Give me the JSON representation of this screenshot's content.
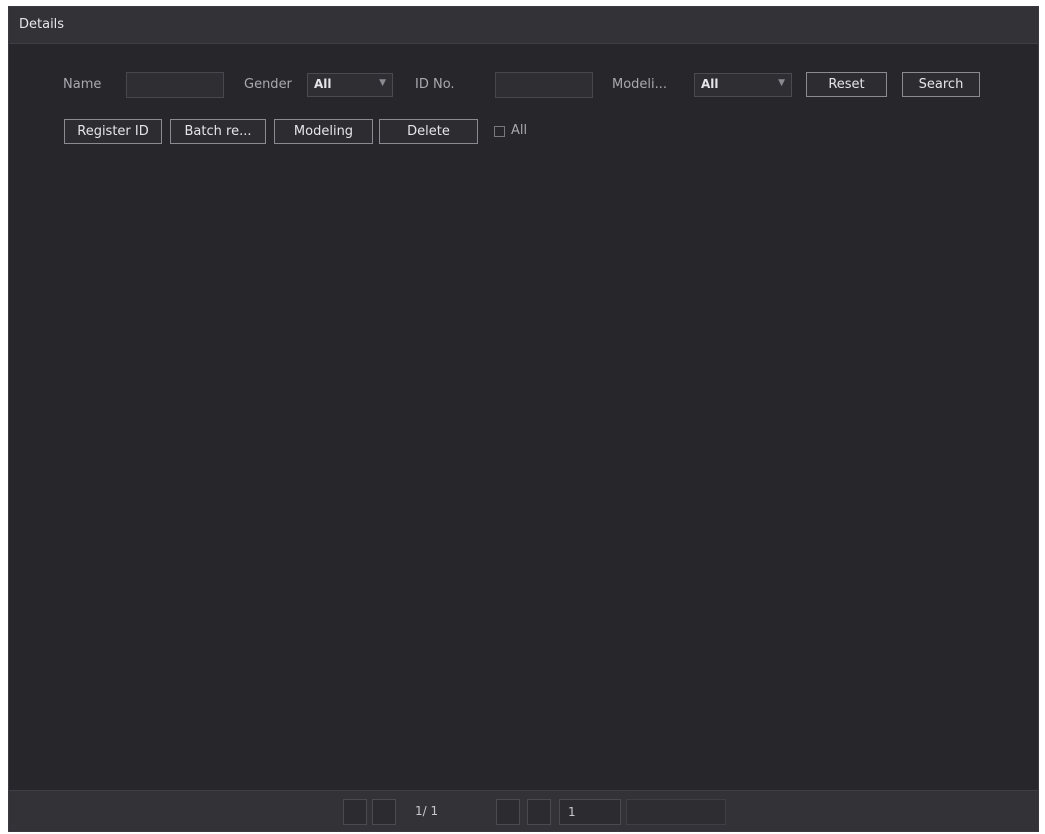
{
  "window": {
    "title": "Details"
  },
  "filters": {
    "name_label": "Name",
    "name_value": "",
    "gender_label": "Gender",
    "gender_value": "All",
    "id_label": "ID No.",
    "id_value": "",
    "modeling_label": "Modeli...",
    "modeling_value": "All",
    "reset_label": "Reset",
    "search_label": "Search"
  },
  "toolbar": {
    "register_label": "Register ID",
    "batch_label": "Batch re...",
    "modeling_label": "Modeling",
    "delete_label": "Delete",
    "all_label": "All",
    "all_checked": false
  },
  "pagination": {
    "page_display": "1/ 1",
    "goto_value": "1"
  },
  "icons": {
    "dropdown": "chevron-down-icon",
    "first": "first-page-icon",
    "prev": "prev-page-icon",
    "next": "next-page-icon",
    "last": "last-page-icon"
  },
  "colors": {
    "background": "#26262b",
    "titlebar": "#323237",
    "button_border": "#8a8a90",
    "text": "#e6e6ea"
  }
}
